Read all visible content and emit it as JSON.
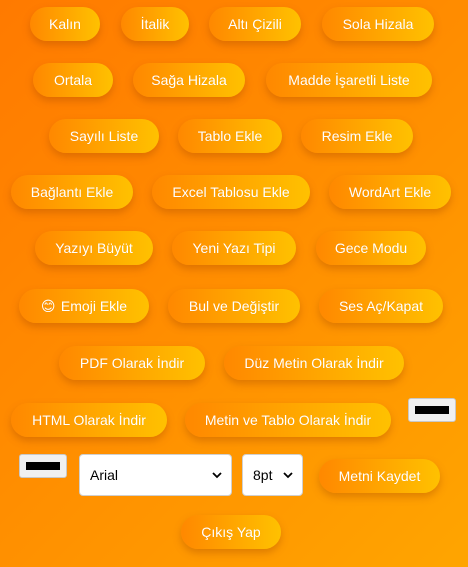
{
  "toolbar": {
    "bold": "Kalın",
    "italic": "İtalik",
    "underline": "Altı Çizili",
    "align_left": "Sola Hizala",
    "center": "Ortala",
    "align_right": "Sağa Hizala",
    "bulleted_list": "Madde İşaretli Liste",
    "numbered_list": "Sayılı Liste",
    "add_table": "Tablo Ekle",
    "add_image": "Resim Ekle",
    "add_link": "Bağlantı Ekle",
    "add_excel_table": "Excel Tablosu Ekle",
    "add_wordart": "WordArt Ekle",
    "grow_text": "Yazıyı Büyüt",
    "new_font": "Yeni Yazı Tipi",
    "night_mode": "Gece Modu",
    "add_emoji": "Emoji Ekle",
    "emoji_glyph": "😊",
    "find_replace": "Bul ve Değiştir",
    "sound_toggle": "Ses Aç/Kapat",
    "download_pdf": "PDF Olarak İndir",
    "download_plain_text": "Düz Metin Olarak İndir",
    "download_html": "HTML Olarak İndir",
    "download_text_table": "Metin ve Tablo Olarak İndir",
    "save_text": "Metni Kaydet",
    "logout": "Çıkış Yap"
  },
  "controls": {
    "font_family": "Arial",
    "font_size": "8pt",
    "text_color": "#000000",
    "bg_color": "#000000"
  },
  "colors": {
    "background_start": "#ff7a00",
    "background_end": "#ffa500",
    "button_start": "#ff8800",
    "button_end": "#ffc100",
    "button_text": "#ffffff"
  }
}
